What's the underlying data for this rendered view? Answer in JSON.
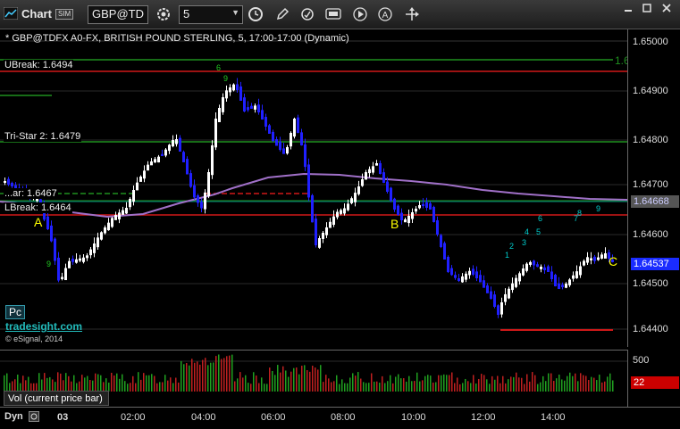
{
  "window": {
    "title": "Chart",
    "sim": "SIM"
  },
  "toolbar": {
    "symbol": "GBP@TD",
    "interval": "5",
    "icons": [
      "gear-icon",
      "clock-icon",
      "pencil-icon",
      "refresh-icon",
      "get-icon",
      "play-icon",
      "alert-icon",
      "drag-icon"
    ]
  },
  "chart": {
    "header": "* GBP@TDFX A0-FX, BRITISH POUND STERLING, 5, 17:00-17:00 (Dynamic)",
    "price_ticks": [
      "1.65000",
      "1.64900",
      "1.64800",
      "1.64700",
      "1.64600",
      "1.64500",
      "1.64400"
    ],
    "time_ticks": [
      "03",
      "02:00",
      "04:00",
      "06:00",
      "08:00",
      "10:00",
      "12:00",
      "14:00"
    ],
    "levels": [
      {
        "label": "UBreak: 1.6494",
        "color": "#d01818"
      },
      {
        "label": "Tri-Star 2: 1.6479",
        "color": "#1f8f1f"
      },
      {
        "label": "...ar: 1.6467",
        "color": "#1f8f1f"
      },
      {
        "label": "LBreak: 1.6464",
        "color": "#d01818"
      }
    ],
    "current_price": "1.64537",
    "ma_price": "1.64668",
    "marks": [
      "A",
      "B",
      "C"
    ],
    "setup_numbers": [
      "1",
      "2",
      "3",
      "4",
      "5",
      "6",
      "7",
      "8",
      "9"
    ],
    "pc_label": "Pc",
    "logo": "tradesight.com",
    "copyright": "© eSignal, 2014",
    "right_edge": "1.6"
  },
  "volume": {
    "label": "Vol (current price bar)",
    "tick": "500",
    "current": "22",
    "current_color": "#cc0000"
  },
  "footer": {
    "dyn": "Dyn"
  },
  "colors": {
    "up": "#ffffff",
    "down": "#2020ff",
    "ma": "#a070c8",
    "teal": "#00cccc"
  }
}
